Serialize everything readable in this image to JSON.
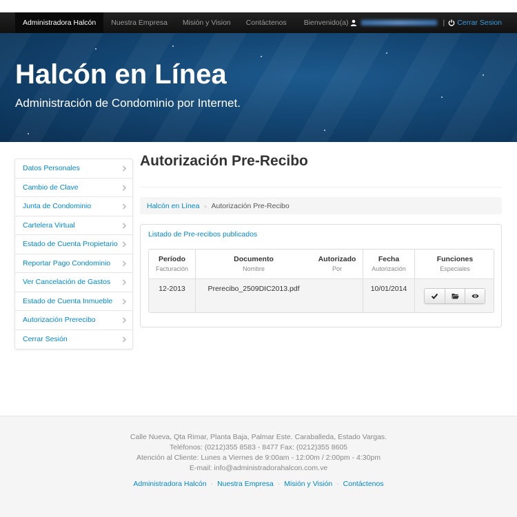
{
  "navbar": {
    "items": [
      {
        "label": "Administradora Halcón",
        "active": true
      },
      {
        "label": "Nuestra Empresa"
      },
      {
        "label": "Misión y Vision"
      },
      {
        "label": "Contáctenos"
      }
    ],
    "welcome": "Bienvenido(a)",
    "separator": "|",
    "logout": "Cerrar Sesion"
  },
  "banner": {
    "title": "Halcón en Línea",
    "subtitle": "Administración de Condominio por Internet."
  },
  "sidebar": {
    "items": [
      {
        "label": "Datos Personales"
      },
      {
        "label": "Cambio de Clave"
      },
      {
        "label": "Junta de Condominio"
      },
      {
        "label": "Cartelera Virtual"
      },
      {
        "label": "Estado de Cuenta Propietario"
      },
      {
        "label": "Reportar Pago Condominio"
      },
      {
        "label": "Ver Cancelación de Gastos"
      },
      {
        "label": "Estado de Cuenta Inmueble"
      },
      {
        "label": "Autorización Prerecibo"
      },
      {
        "label": "Cerrar Sesión"
      }
    ]
  },
  "main": {
    "title": "Autorización Pre-Recibo",
    "breadcrumb": {
      "home": "Halcón en Línea",
      "separator": "»",
      "current": "Autorización Pre-Recibo"
    },
    "panel": {
      "heading": "Listado de Pre-recibos publicados",
      "columns": [
        {
          "title": "Período",
          "sub": "Facturación"
        },
        {
          "title": "Documento",
          "sub": "Nombre"
        },
        {
          "title": "Autorizado",
          "sub": "Por"
        },
        {
          "title": "Fecha",
          "sub": "Autorización"
        },
        {
          "title": "Funciones",
          "sub": "Especiales"
        }
      ],
      "rows": [
        {
          "periodo": "12-2013",
          "documento": "Prerecibo_2509DIC2013.pdf",
          "autorizado": "",
          "fecha": "10/01/2014"
        }
      ],
      "actions": [
        "check-icon",
        "folder-open-icon",
        "eye-icon"
      ]
    }
  },
  "footer": {
    "lines": [
      "Calle Nueva, Qta Rimar, Planta Baja, Palmar Este. Caraballeda, Estado Vargas.",
      "Teléfonos: (0212)355 8583 - 8477 Fax: (0212)355 8605",
      "Atención al Cliente: Lunes a Viernes de 9:00am - 12:00m / 2:00pm - 4:30pm",
      "E-mail: info@administradorahalcon.com.ve"
    ],
    "links": [
      "Administradora Halcón",
      "Nuestra Empresa",
      "Misión y Visión",
      "Contáctenos"
    ],
    "link_separator": "·"
  },
  "colors": {
    "link": "#0088cc",
    "navbar": "#1a1a1a",
    "banner": "#134673"
  }
}
